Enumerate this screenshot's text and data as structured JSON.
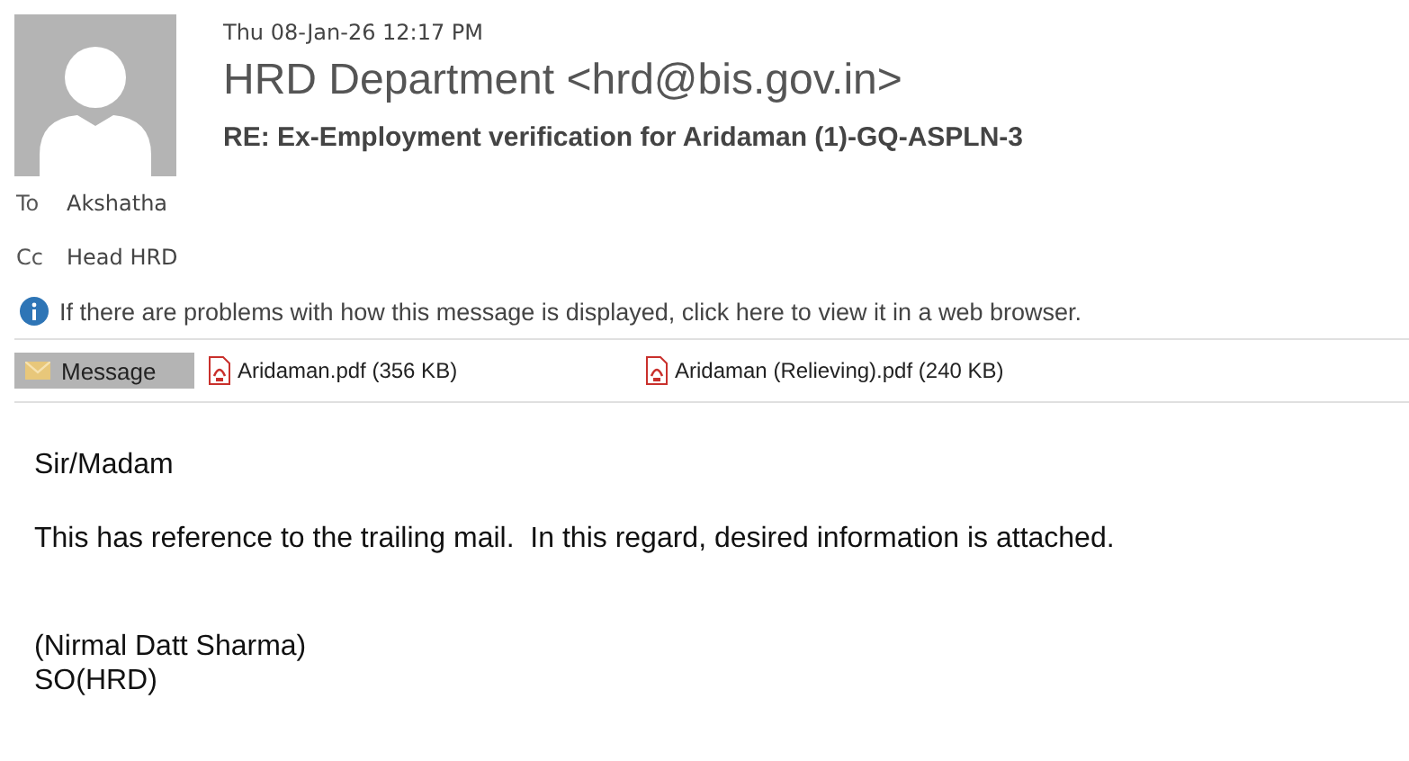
{
  "header": {
    "date": "Thu 08-Jan-26 12:17 PM",
    "sender": "HRD Department <hrd@bis.gov.in>",
    "subject": "RE: Ex-Employment verification for Aridaman (1)-GQ-ASPLN-3"
  },
  "recipients": [
    {
      "label": "To",
      "name": "Akshatha"
    },
    {
      "label": "Cc",
      "name": "Head HRD"
    }
  ],
  "info_bar": "If there are problems with how this message is displayed, click here to view it in a web browser.",
  "attachments": [
    {
      "kind": "message",
      "label": "Message",
      "selected": true
    },
    {
      "kind": "file",
      "label": "Aridaman.pdf (356 KB)",
      "selected": false
    },
    {
      "kind": "file",
      "label": "Aridaman (Relieving).pdf (240 KB)",
      "selected": false
    }
  ],
  "body": {
    "greeting": "Sir/Madam",
    "paragraph": "This has reference to the trailing mail.  In this regard, desired information is attached.",
    "signature": [
      "(Nirmal Datt Sharma)",
      "SO(HRD)"
    ]
  }
}
